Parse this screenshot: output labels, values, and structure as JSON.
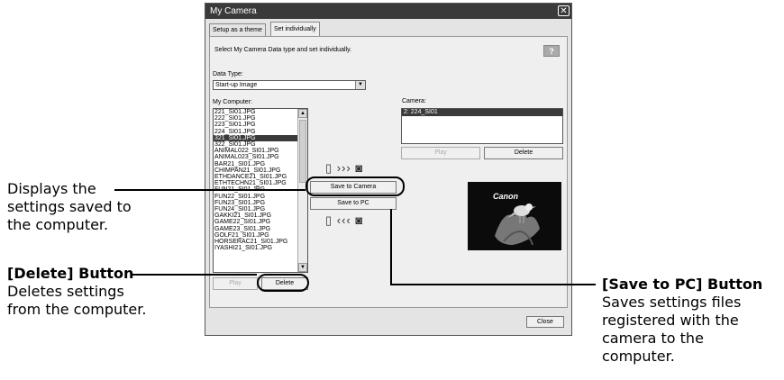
{
  "window": {
    "title": "My Camera",
    "close_glyph": "✕",
    "tabs": [
      "Setup as a theme",
      "Set individually"
    ],
    "instruction": "Select My Camera Data type and set individually.",
    "help_glyph": "?",
    "data_type_label": "Data Type:",
    "data_type_value": "Start-up Image",
    "my_computer_label": "My Computer:",
    "my_computer_files": [
      "221_SI01.JPG",
      "222_SI01.JPG",
      "223_SI01.JPG",
      "224_SI01.JPG",
      "321_SI01.JPG",
      "322_SI01.JPG",
      "ANIMAL022_SI01.JPG",
      "ANIMAL023_SI01.JPG",
      "BAR21_SI01.JPG",
      "CHIMPAN21_SI01.JPG",
      "ETHDANCE21_SI01.JPG",
      "ETHTECHN21_SI01.JPG",
      "FUN21_SI01.JPG",
      "FUN22_SI01.JPG",
      "FUN23_SI01.JPG",
      "FUN24_SI01.JPG",
      "GAKKI21_SI01.JPG",
      "GAME22_SI01.JPG",
      "GAME23_SI01.JPG",
      "GOLF21_SI01.JPG",
      "HORSERAC21_SI01.JPG",
      "IYASHI21_SI01.JPG"
    ],
    "selected_file": "321_SI01.JPG",
    "left_play": "Play",
    "left_delete": "Delete",
    "save_to_camera": "Save to Camera",
    "save_to_pc": "Save to PC",
    "camera_label": "Camera:",
    "camera_item": "2: 224_SI01",
    "camera_play": "Play",
    "camera_delete": "Delete",
    "photo_brand": "Canon",
    "close": "Close",
    "to_camera_icons": "▯ ››› ◙",
    "to_pc_icons": "▯ ‹‹‹ ◙"
  },
  "annotations": {
    "computer_list": {
      "line1": "Displays the",
      "line2": "settings saved to",
      "line3": "the computer."
    },
    "delete_button": {
      "title": "[Delete] Button",
      "line1": "Deletes settings",
      "line2": "from the computer."
    },
    "save_to_pc": {
      "title": "[Save to PC] Button",
      "line1": "Saves settings files",
      "line2": "registered with the",
      "line3": "camera to the",
      "line4": "computer."
    }
  }
}
